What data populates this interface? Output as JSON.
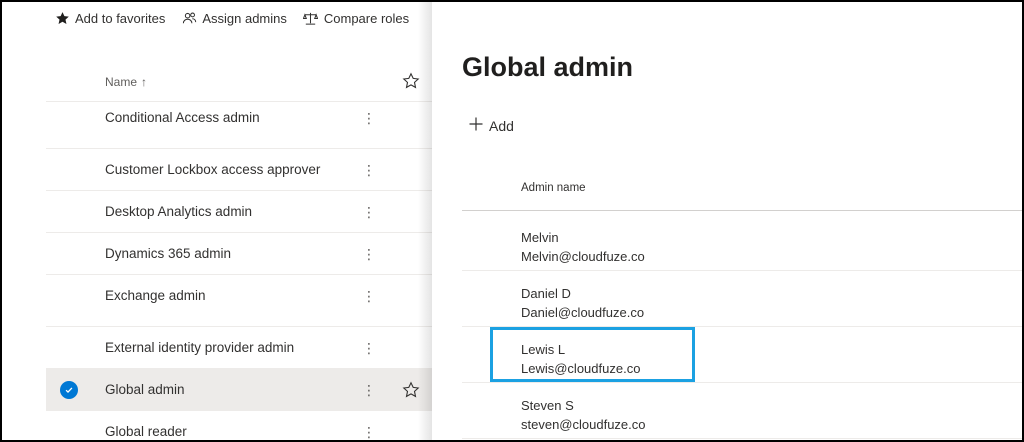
{
  "toolbar": {
    "favorites_label": "Add to favorites",
    "assign_label": "Assign admins",
    "compare_label": "Compare roles"
  },
  "roles_list": {
    "header_name": "Name",
    "sort_indicator": "↑",
    "more_glyph": "⋮",
    "rows": [
      {
        "label": "Conditional Access admin",
        "selected": false
      },
      {
        "label": "Customer Lockbox access approver",
        "selected": false
      },
      {
        "label": "Desktop Analytics admin",
        "selected": false
      },
      {
        "label": "Dynamics 365 admin",
        "selected": false
      },
      {
        "label": "Exchange admin",
        "selected": false
      },
      {
        "label": "External identity provider admin",
        "selected": false
      },
      {
        "label": "Global admin",
        "selected": true
      },
      {
        "label": "Global reader",
        "selected": false
      }
    ]
  },
  "panel": {
    "title": "Global admin",
    "add_label": "Add",
    "column_header": "Admin name",
    "admins": [
      {
        "name": "Melvin",
        "email": "Melvin@cloudfuze.co"
      },
      {
        "name": "Daniel D",
        "email": "Daniel@cloudfuze.co"
      },
      {
        "name": "Lewis L",
        "email": "Lewis@cloudfuze.co"
      },
      {
        "name": "Steven S",
        "email": "steven@cloudfuze.co"
      }
    ]
  },
  "colors": {
    "accent": "#0078d4",
    "highlight_box": "#1ba1e2",
    "selected_row": "#edebe9"
  },
  "icons": {
    "favorites": "star-filled-icon",
    "assign": "people-icon",
    "compare": "scales-icon",
    "header_star": "star-outline-icon",
    "add": "plus-icon"
  }
}
